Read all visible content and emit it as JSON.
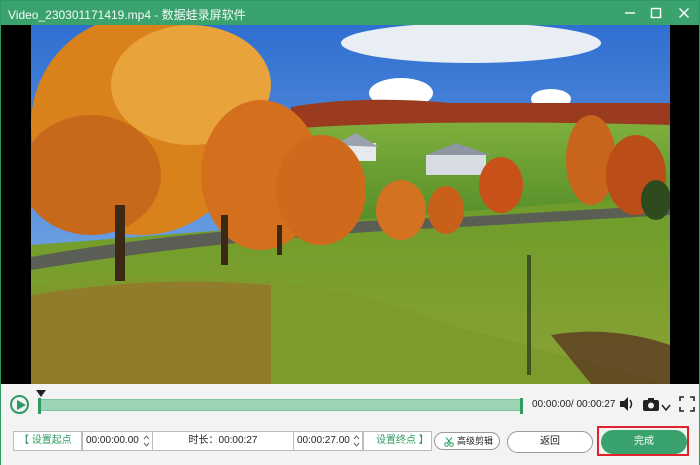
{
  "window": {
    "title": "Video_230301171419.mp4 - 数据蛙录屏软件",
    "accent_color": "#3aa36d",
    "controls": [
      "minimize-icon",
      "maximize-icon",
      "close-icon"
    ]
  },
  "player": {
    "elapsed": "00:00:00",
    "total": "00:00:27",
    "time_readout": "00:00:00/ 00:00:27",
    "progress": 0,
    "icons": [
      "play-icon",
      "volume-icon",
      "camera-icon",
      "chevron-down-icon",
      "fullscreen-icon"
    ]
  },
  "trim": {
    "set_start_label": "【 设置起点",
    "start_time": "00:00:00.00",
    "duration_label": "时长：00:00:27",
    "end_time": "00:00:27.00",
    "set_end_label": "设置终点 】",
    "advanced_label": "高级剪辑",
    "back_label": "返回",
    "done_label": "完成"
  }
}
